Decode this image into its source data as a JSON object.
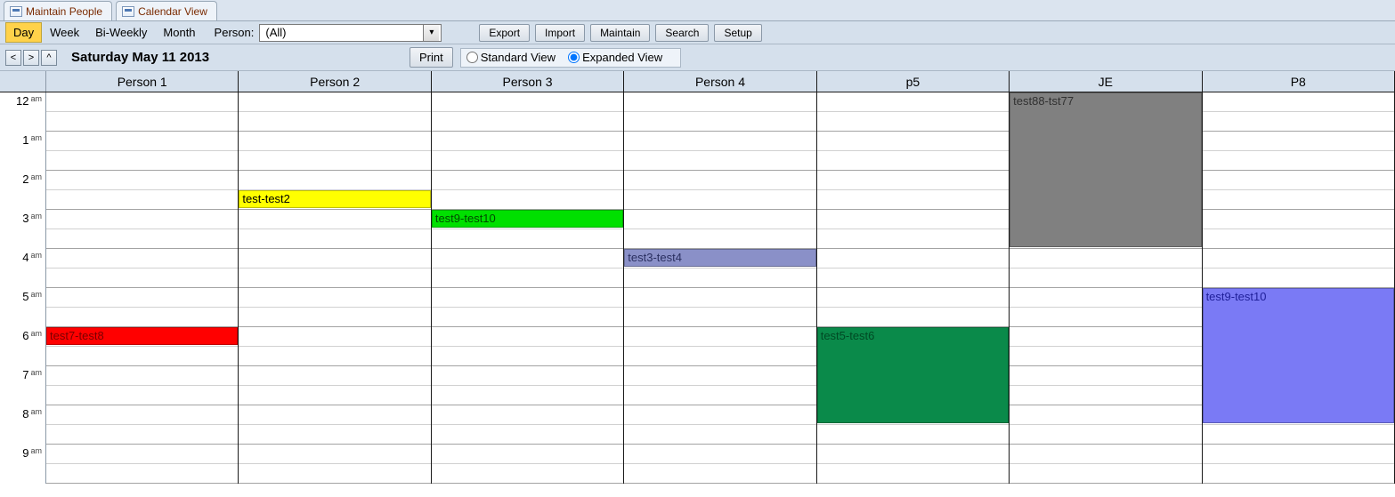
{
  "docTabs": [
    {
      "label": "Maintain People"
    },
    {
      "label": "Calendar View"
    }
  ],
  "viewModes": {
    "items": [
      "Day",
      "Week",
      "Bi-Weekly",
      "Month"
    ],
    "active": "Day"
  },
  "personFilter": {
    "label": "Person:",
    "value": "(All)"
  },
  "buttons": {
    "export": "Export",
    "import": "Import",
    "maintain": "Maintain",
    "search": "Search",
    "setup": "Setup",
    "print": "Print"
  },
  "nav": {
    "prev": "<",
    "next": ">",
    "up": "^"
  },
  "dateTitle": "Saturday May 11 2013",
  "viewRadios": {
    "standard": "Standard View",
    "expanded": "Expanded View",
    "selected": "expanded"
  },
  "people": [
    "Person 1",
    "Person 2",
    "Person 3",
    "Person 4",
    "p5",
    "JE",
    "P8"
  ],
  "hours": [
    {
      "n": "12",
      "ap": "am"
    },
    {
      "n": "1",
      "ap": "am"
    },
    {
      "n": "2",
      "ap": "am"
    },
    {
      "n": "3",
      "ap": "am"
    },
    {
      "n": "4",
      "ap": "am"
    },
    {
      "n": "5",
      "ap": "am"
    },
    {
      "n": "6",
      "ap": "am"
    },
    {
      "n": "7",
      "ap": "am"
    },
    {
      "n": "8",
      "ap": "am"
    },
    {
      "n": "9",
      "ap": "am"
    }
  ],
  "slotHeight": 22,
  "events": [
    {
      "col": 0,
      "startSlot": 12,
      "span": 1,
      "label": "test7-test8",
      "bg": "#ff0000",
      "fg": "#7a0000"
    },
    {
      "col": 1,
      "startSlot": 5,
      "span": 1,
      "label": "test-test2",
      "bg": "#ffff00",
      "fg": "#000000"
    },
    {
      "col": 2,
      "startSlot": 6,
      "span": 1,
      "label": "test9-test10",
      "bg": "#00e000",
      "fg": "#004a00"
    },
    {
      "col": 3,
      "startSlot": 8,
      "span": 1,
      "label": "test3-test4",
      "bg": "#8a90c8",
      "fg": "#2a2f60"
    },
    {
      "col": 4,
      "startSlot": 12,
      "span": 5,
      "label": "test5-test6",
      "bg": "#0a8a4a",
      "fg": "#004a24"
    },
    {
      "col": 5,
      "startSlot": 0,
      "span": 8,
      "label": "test88-tst77",
      "bg": "#808080",
      "fg": "#303030"
    },
    {
      "col": 6,
      "startSlot": 10,
      "span": 7,
      "label": "test9-test10",
      "bg": "#7a7af5",
      "fg": "#20209a"
    }
  ]
}
